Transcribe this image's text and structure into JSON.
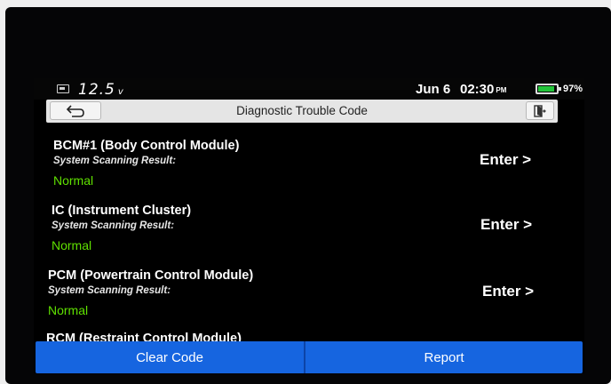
{
  "status": {
    "voltage": "12.5",
    "voltage_unit": "v",
    "date": "Jun 6",
    "time": "02:30",
    "ampm": "PM",
    "battery_percent": "97%"
  },
  "header": {
    "title": "Diagnostic Trouble Code"
  },
  "modules": [
    {
      "name": "BCM#1 (Body Control Module)",
      "scan_label": "System Scanning Result:",
      "result": "Normal",
      "action": "Enter >"
    },
    {
      "name": "IC (Instrument Cluster)",
      "scan_label": "System Scanning Result:",
      "result": "Normal",
      "action": "Enter >"
    },
    {
      "name": "PCM (Powertrain Control Module)",
      "scan_label": "System Scanning Result:",
      "result": "Normal",
      "action": "Enter >"
    },
    {
      "name": "RCM (Restraint Control Module)",
      "scan_label": "",
      "result": "",
      "action": ""
    }
  ],
  "footer": {
    "clear_label": "Clear Code",
    "report_label": "Report"
  },
  "colors": {
    "accent": "#1665e0",
    "normal": "#5fe000",
    "battery": "#23c43a"
  },
  "icons": {
    "back": "back-arrow-icon",
    "exit": "exit-door-icon",
    "vehicle_battery": "car-battery-icon",
    "device_battery": "battery-icon"
  }
}
